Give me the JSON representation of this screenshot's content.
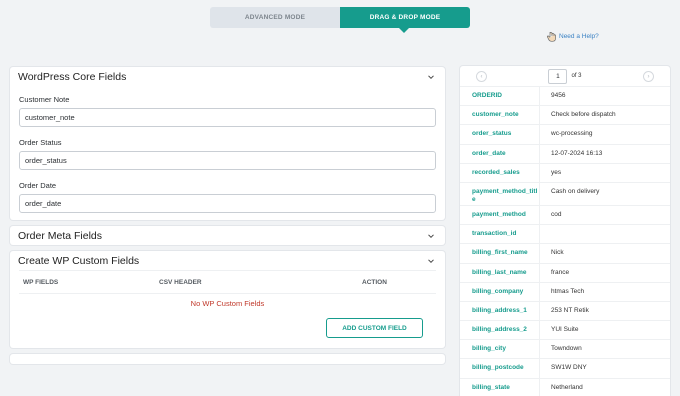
{
  "mode": {
    "advanced": "ADVANCED MODE",
    "dragdrop": "DRAG & DROP MODE"
  },
  "help": {
    "label": "Need a Help?"
  },
  "core": {
    "title": "WordPress Core Fields",
    "fields": [
      {
        "label": "Customer Note",
        "value": "customer_note"
      },
      {
        "label": "Order Status",
        "value": "order_status"
      },
      {
        "label": "Order Date",
        "value": "order_date"
      }
    ]
  },
  "meta": {
    "title": "Order Meta Fields"
  },
  "custom": {
    "title": "Create WP Custom Fields",
    "columns": [
      "WP FIELDS",
      "CSV HEADER",
      "ACTION"
    ],
    "empty": "No WP Custom Fields",
    "add_button": "ADD CUSTOM FIELD"
  },
  "pager": {
    "prev": "‹",
    "next": "›",
    "page": "1",
    "of": "of 3"
  },
  "record": [
    {
      "key": "ORDERID",
      "value": "9456"
    },
    {
      "key": "customer_note",
      "value": "Check before dispatch"
    },
    {
      "key": "order_status",
      "value": "wc-processing"
    },
    {
      "key": "order_date",
      "value": "12-07-2024 16:13"
    },
    {
      "key": "recorded_sales",
      "value": "yes"
    },
    {
      "key": "payment_method_title",
      "value": "Cash on delivery"
    },
    {
      "key": "payment_method",
      "value": "cod"
    },
    {
      "key": "transaction_id",
      "value": ""
    },
    {
      "key": "billing_first_name",
      "value": "Nick"
    },
    {
      "key": "billing_last_name",
      "value": "france"
    },
    {
      "key": "billing_company",
      "value": "htmas Tech"
    },
    {
      "key": "billing_address_1",
      "value": "253 NT Retik"
    },
    {
      "key": "billing_address_2",
      "value": "YUI Suite"
    },
    {
      "key": "billing_city",
      "value": "Towndown"
    },
    {
      "key": "billing_postcode",
      "value": "SW1W DNY"
    },
    {
      "key": "billing_state",
      "value": "Netherland"
    }
  ],
  "colors": {
    "accent": "#169c8d",
    "error": "#c0392b",
    "link": "#3b82c4"
  },
  "icons": {
    "help": "hand-icon",
    "expand": "chevron-down-icon"
  }
}
